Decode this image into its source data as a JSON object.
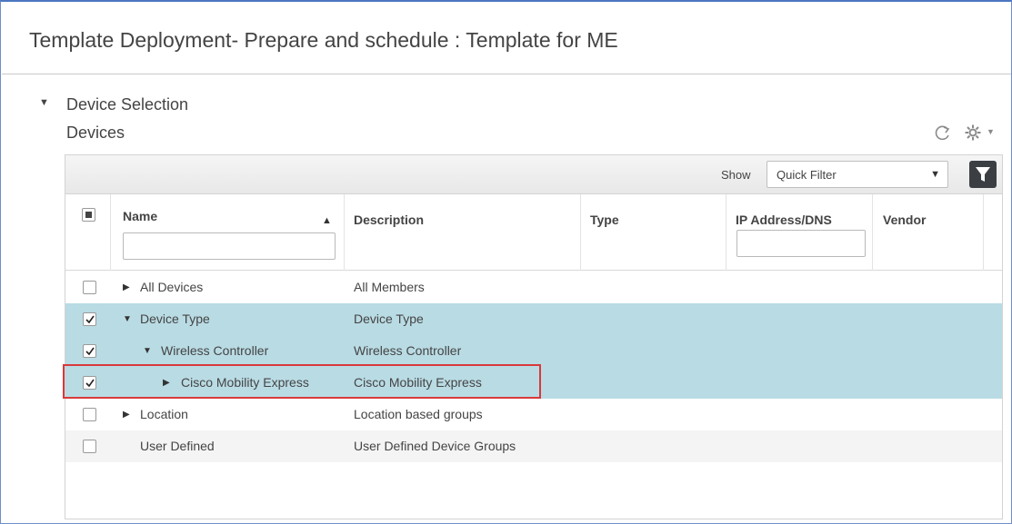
{
  "page": {
    "title": "Template Deployment- Prepare and schedule : Template for ME"
  },
  "section": {
    "title": "Device Selection",
    "subtitle": "Devices"
  },
  "toolbar": {
    "show_label": "Show",
    "filter_value": "Quick Filter"
  },
  "columns": {
    "name": "Name",
    "description": "Description",
    "type": "Type",
    "ip": "IP Address/DNS",
    "vendor": "Vendor"
  },
  "rows": [
    {
      "name": "All Devices",
      "description": "All Members",
      "checked": false,
      "expander": "collapsed"
    },
    {
      "name": "Device Type",
      "description": "Device Type",
      "checked": true,
      "expander": "expanded"
    },
    {
      "name": "Wireless Controller",
      "description": "Wireless Controller",
      "checked": true,
      "expander": "expanded"
    },
    {
      "name": "Cisco Mobility Express",
      "description": "Cisco Mobility Express",
      "checked": true,
      "expander": "collapsed"
    },
    {
      "name": "Location",
      "description": "Location based groups",
      "checked": false,
      "expander": "collapsed"
    },
    {
      "name": "User Defined",
      "description": "User Defined Device Groups",
      "checked": false,
      "expander": "none"
    }
  ],
  "colors": {
    "selected_row": "#b9dbe4",
    "highlight": "#d9393b"
  }
}
